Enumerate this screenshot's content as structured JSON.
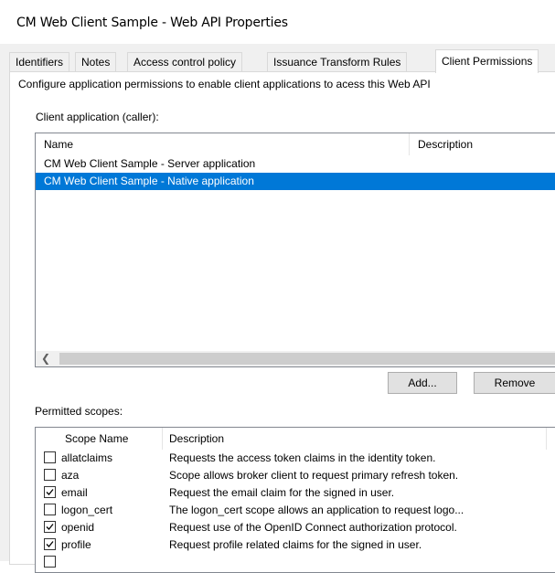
{
  "window": {
    "title": "CM Web Client Sample - Web API Properties"
  },
  "tabs": [
    {
      "label": "Identifiers"
    },
    {
      "label": "Notes"
    },
    {
      "label": "Access control policy"
    },
    {
      "label": "Issuance Transform Rules"
    },
    {
      "label": "Client Permissions"
    }
  ],
  "active_tab": "Client Permissions",
  "description": "Configure application permissions to enable client applications to acess this Web API",
  "client_app": {
    "label": "Client application (caller):",
    "columns": [
      "Name",
      "Description"
    ],
    "rows": [
      {
        "name": "CM Web Client Sample - Server application",
        "selected": false
      },
      {
        "name": "CM Web Client Sample - Native application",
        "selected": true
      }
    ]
  },
  "buttons": {
    "add": "Add...",
    "remove": "Remove"
  },
  "scopes": {
    "label": "Permitted scopes:",
    "columns": [
      "Scope Name",
      "Description"
    ],
    "rows": [
      {
        "name": "allatclaims",
        "checked": false,
        "description": "Requests the access token claims in the identity token."
      },
      {
        "name": "aza",
        "checked": false,
        "description": "Scope allows broker client to request primary refresh token."
      },
      {
        "name": "email",
        "checked": true,
        "description": "Request the email claim for the signed in user."
      },
      {
        "name": "logon_cert",
        "checked": false,
        "description": "The logon_cert scope allows an application to request logo..."
      },
      {
        "name": "openid",
        "checked": true,
        "description": "Request use of the OpenID Connect authorization protocol."
      },
      {
        "name": "profile",
        "checked": true,
        "description": "Request profile related claims for the signed in user."
      }
    ]
  },
  "colors": {
    "selection": "#0078d7",
    "dialog_bg": "#f0f0f0"
  }
}
